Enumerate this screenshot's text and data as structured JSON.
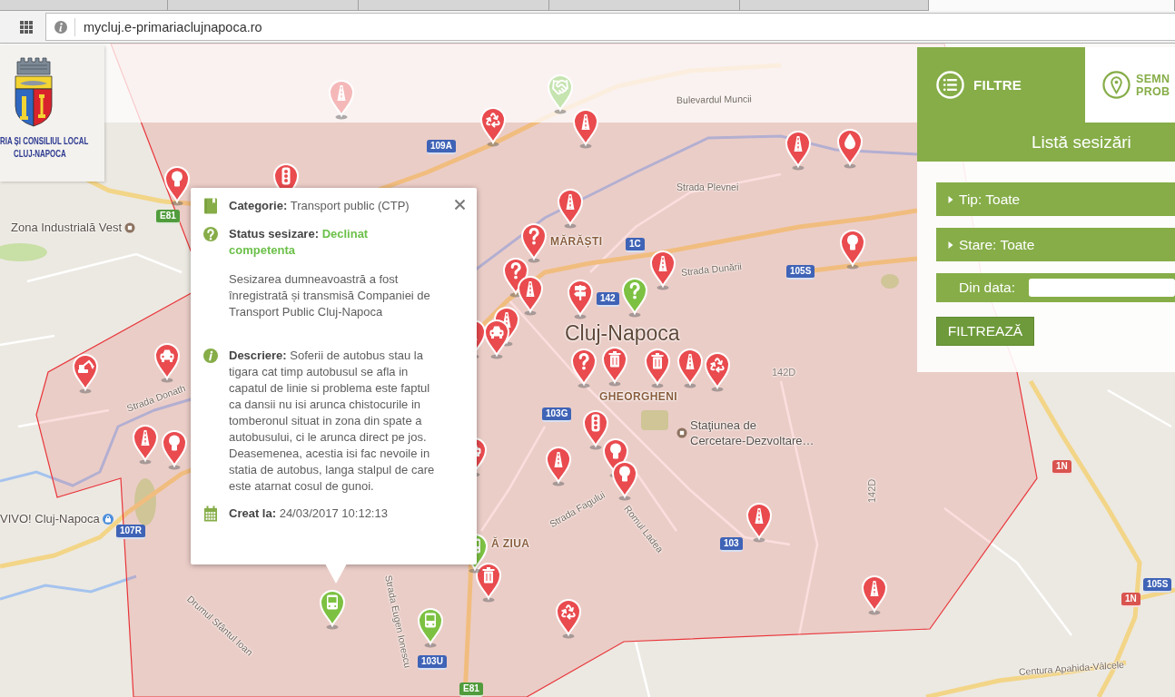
{
  "browser": {
    "tabs": [
      {
        "selected": false
      },
      {
        "selected": false
      },
      {
        "selected": false
      },
      {
        "selected": false
      },
      {
        "selected": false
      },
      {
        "selected": true
      }
    ],
    "address": "mycluj.e-primariaclujnapoca.ro"
  },
  "logo": {
    "lines": [
      "RIA ȘI CONSILIUL LOCAL",
      "CLUJ-NAPOCA"
    ]
  },
  "map": {
    "labels": [
      {
        "text": "Bulevardul Muncii",
        "kind": "street"
      },
      {
        "text": "Strada Plevnei",
        "kind": "street"
      },
      {
        "text": "MĂRĂȘTI",
        "kind": "district"
      },
      {
        "text": "Strada Dunării",
        "kind": "street"
      },
      {
        "text": "Cluj-Napoca",
        "kind": "city"
      },
      {
        "text": "GHEORGHENI",
        "kind": "district"
      },
      {
        "lines": [
          "Staţiunea de",
          "Cercetare-Dezvoltare…"
        ],
        "kind": "place"
      },
      {
        "text": "142D",
        "kind": "road_number"
      },
      {
        "text": "142D",
        "kind": "road_number"
      },
      {
        "text": "Strada Fagului",
        "kind": "street"
      },
      {
        "text": "Romul Ladea",
        "kind": "street"
      },
      {
        "text": "Strada Donath",
        "kind": "street"
      },
      {
        "text": "Drumul Sfântul Ioan",
        "kind": "street"
      },
      {
        "text": "Strada Eugen Ionescu",
        "kind": "street"
      },
      {
        "text": "Ă ZIUA",
        "kind": "district"
      },
      {
        "text": "Centura Apahida-Vâlcele",
        "kind": "street"
      },
      {
        "text": "Zona Industrială Vest",
        "kind": "place"
      },
      {
        "text": "VIVO! Cluj-Napoca",
        "kind": "place"
      },
      {
        "text": "E81",
        "kind": "european_road"
      },
      {
        "text": "109A",
        "kind": "county_road"
      },
      {
        "text": "1C",
        "kind": "county_road"
      },
      {
        "text": "105S",
        "kind": "county_road"
      },
      {
        "text": "142",
        "kind": "county_road"
      },
      {
        "text": "103G",
        "kind": "county_road"
      },
      {
        "text": "107R",
        "kind": "county_road"
      },
      {
        "text": "103U",
        "kind": "county_road"
      },
      {
        "text": "E81",
        "kind": "european_road"
      },
      {
        "text": "103",
        "kind": "county_road"
      },
      {
        "text": "1N",
        "kind": "national_road"
      },
      {
        "text": "1N",
        "kind": "national_road"
      },
      {
        "text": "105S",
        "kind": "county_road"
      }
    ],
    "faded_pins": [
      {
        "kind": "road",
        "color": "#f5b8b9"
      },
      {
        "kind": "handshake",
        "color": "#c6e4b0"
      }
    ],
    "pins": [
      {
        "kind": "recycle",
        "color": "#e94b4f"
      },
      {
        "kind": "road",
        "color": "#e94b4f"
      },
      {
        "kind": "road",
        "color": "#e94b4f"
      },
      {
        "kind": "drop",
        "color": "#e94b4f"
      },
      {
        "kind": "bulb",
        "color": "#e94b4f"
      },
      {
        "kind": "traffic_light",
        "color": "#e94b4f"
      },
      {
        "kind": "road",
        "color": "#e94b4f"
      },
      {
        "kind": "question",
        "color": "#e94b4f"
      },
      {
        "kind": "question",
        "color": "#e94b4f"
      },
      {
        "kind": "road",
        "color": "#e94b4f"
      },
      {
        "kind": "road",
        "color": "#e94b4f"
      },
      {
        "kind": "bulb",
        "color": "#e94b4f"
      },
      {
        "kind": "signpost",
        "color": "#e94b4f"
      },
      {
        "kind": "question",
        "color": "#7dc142"
      },
      {
        "kind": "trash",
        "color": "#e94b4f"
      },
      {
        "kind": "trash",
        "color": "#e94b4f"
      },
      {
        "kind": "road",
        "color": "#e94b4f"
      },
      {
        "kind": "car",
        "color": "#e94b4f"
      },
      {
        "kind": "question",
        "color": "#e94b4f"
      },
      {
        "kind": "road",
        "color": "#e94b4f"
      },
      {
        "kind": "recycle",
        "color": "#e94b4f"
      },
      {
        "kind": "excavator",
        "color": "#e94b4f"
      },
      {
        "kind": "car",
        "color": "#e94b4f"
      },
      {
        "kind": "road",
        "color": "#e94b4f"
      },
      {
        "kind": "bulb",
        "color": "#e94b4f"
      },
      {
        "kind": "traffic_light",
        "color": "#e94b4f"
      },
      {
        "kind": "bulb",
        "color": "#e94b4f"
      },
      {
        "kind": "road",
        "color": "#e94b4f"
      },
      {
        "kind": "bulb",
        "color": "#e94b4f"
      },
      {
        "kind": "road",
        "color": "#e94b4f"
      },
      {
        "kind": "road",
        "color": "#e94b4f"
      },
      {
        "kind": "trash",
        "color": "#e94b4f"
      },
      {
        "kind": "recycle",
        "color": "#e94b4f"
      },
      {
        "kind": "bus",
        "color": "#7dc142"
      },
      {
        "kind": "bus",
        "color": "#7dc142"
      },
      {
        "kind": "road",
        "color": "#e94b4f"
      },
      {
        "kind": "car",
        "color": "#e94b4f"
      },
      {
        "kind": "bus",
        "color": "#7dc142"
      }
    ]
  },
  "popup": {
    "category": {
      "label": "Categorie:",
      "value": "Transport public (CTP)"
    },
    "status": {
      "label": "Status sesizare:",
      "value": "Declinat competenta"
    },
    "message": "Sesizarea dumneavoastră a fost înregistrată și transmisă Companiei de Transport Public Cluj-Napoca",
    "description": {
      "label": "Descriere:",
      "value": "Soferii de autobus stau la tigara cat timp autobusul se afla in capatul de linie si problema este faptul ca dansii nu isi arunca chistocurile in tomberonul situat in zona din spate a autobusului, ci le arunca direct pe jos. Deasemenea, acestia isi fac nevoile in statia de autobus, langa stalpul de care este atarnat cosul de gunoi."
    },
    "created": {
      "label": "Creat la:",
      "value": "24/03/2017 10:12:13"
    }
  },
  "panel": {
    "tabs": [
      {
        "label": "FILTRE",
        "selected": true
      },
      {
        "label": "SEMN PROB",
        "selected": false
      }
    ],
    "title": "Listă sesizări",
    "filters": [
      {
        "label": "Tip: Toate",
        "expanded": false
      },
      {
        "label": "Stare: Toate",
        "expanded": false
      }
    ],
    "date": {
      "label": "Din data:"
    },
    "button": "FILTREAZĂ"
  }
}
